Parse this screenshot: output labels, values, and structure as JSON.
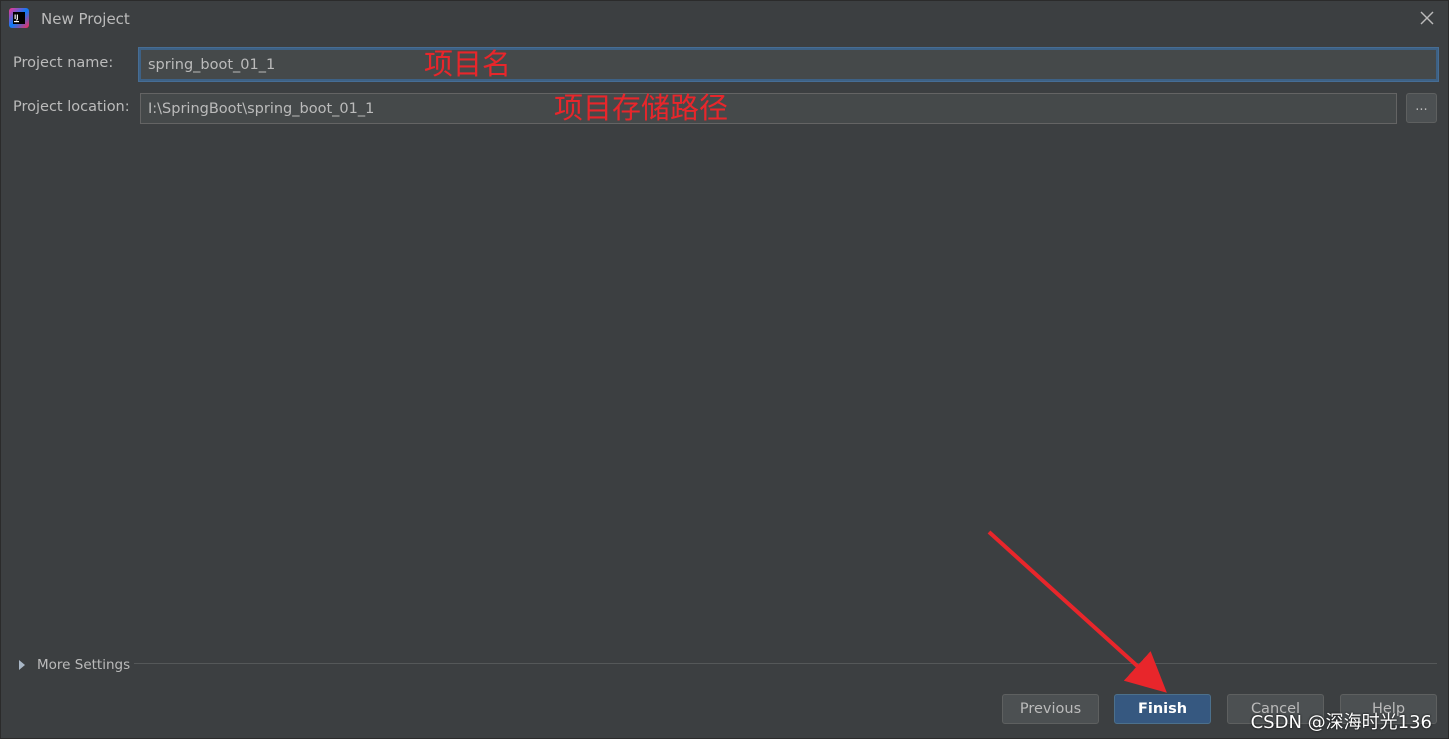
{
  "window": {
    "title": "New Project",
    "icon": "intellij-idea-icon"
  },
  "form": {
    "name_label": "Project name:",
    "name_value": "spring_boot_01_1",
    "location_label": "Project location:",
    "location_value": "I:\\SpringBoot\\spring_boot_01_1",
    "browse_label": "..."
  },
  "annotations": {
    "name_note": "项目名",
    "location_note": "项目存储路径",
    "color": "#e8262b"
  },
  "more_settings": {
    "label": "More Settings"
  },
  "buttons": {
    "previous": "Previous",
    "finish": "Finish",
    "cancel": "Cancel",
    "help": "Help"
  },
  "watermark": "CSDN @深海时光136",
  "colors": {
    "background": "#3c3f41",
    "field": "#45494a",
    "focus": "#3d6185",
    "primary_button": "#365880",
    "text": "#bbbbbb"
  }
}
